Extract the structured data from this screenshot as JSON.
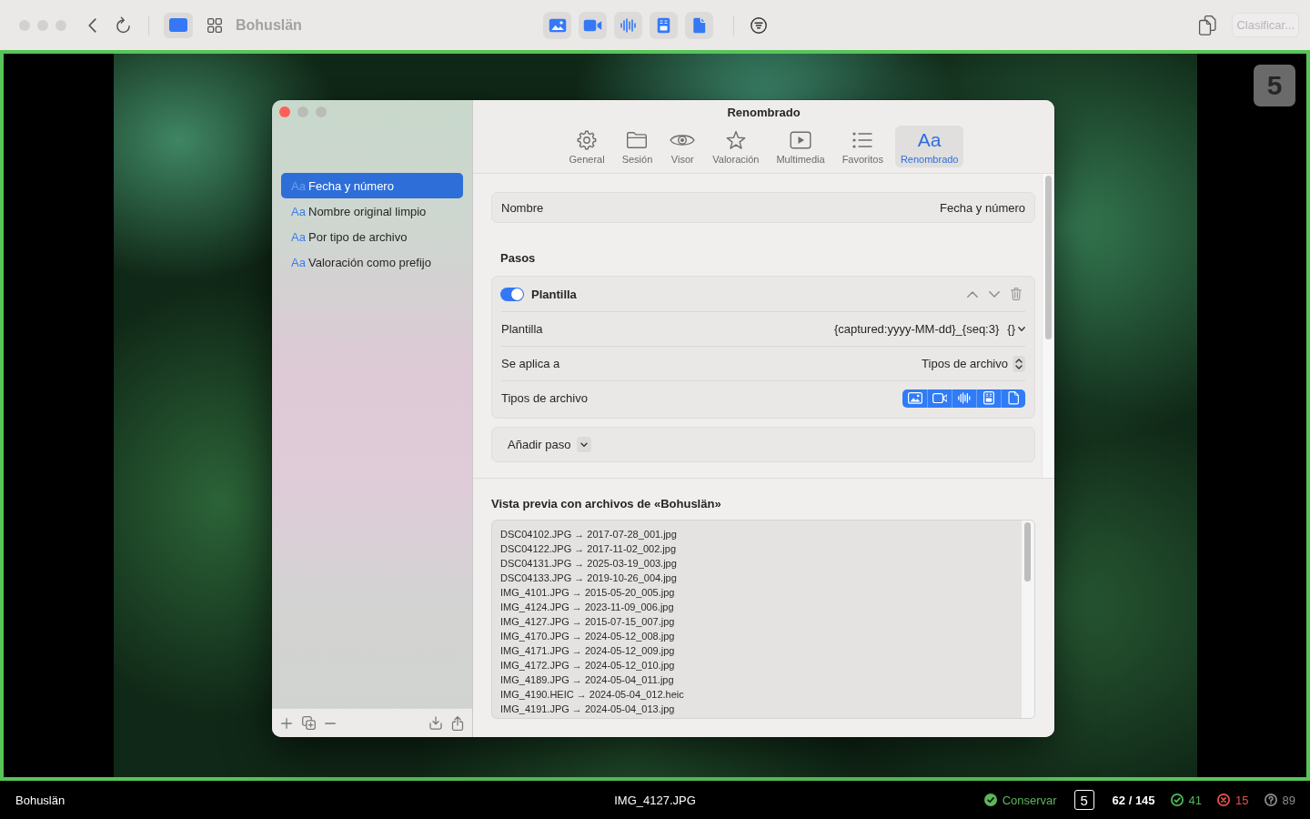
{
  "toolbar": {
    "title": "Bohuslän",
    "media_filters": [
      {
        "kind": "photo"
      },
      {
        "kind": "video"
      },
      {
        "kind": "audio"
      },
      {
        "kind": "document"
      },
      {
        "kind": "file"
      }
    ],
    "sort_button": {
      "label": "Clasificar...",
      "disabled": true
    }
  },
  "viewer": {
    "rating_badge": "5"
  },
  "dialog": {
    "title": "Renombrado",
    "tabs": [
      {
        "kind": "gear",
        "label": "General",
        "selected": false
      },
      {
        "kind": "folder",
        "label": "Sesión",
        "selected": false
      },
      {
        "kind": "eye",
        "label": "Visor",
        "selected": false
      },
      {
        "kind": "star",
        "label": "Valoración",
        "selected": false
      },
      {
        "kind": "play",
        "label": "Multimedia",
        "selected": false
      },
      {
        "kind": "list",
        "label": "Favoritos",
        "selected": false
      },
      {
        "kind": "glyph",
        "glyph": "Aa",
        "label": "Renombrado",
        "selected": true
      }
    ],
    "presets": [
      {
        "glyph": "Aa",
        "label": "Fecha y número",
        "selected": true
      },
      {
        "glyph": "Aa",
        "label": "Nombre original limpio",
        "selected": false
      },
      {
        "glyph": "Aa",
        "label": "Por tipo de archivo",
        "selected": false
      },
      {
        "glyph": "Aa",
        "label": "Valoración como prefijo",
        "selected": false
      }
    ],
    "name_field": {
      "label": "Nombre",
      "value": "Fecha y número"
    },
    "steps_heading": "Pasos",
    "steps": [
      {
        "title": "Plantilla",
        "enabled": true,
        "rows": [
          {
            "kind": "template",
            "label": "Plantilla",
            "value": "{captured:yyyy-MM-dd}_{seq:3}",
            "token_button": "{}"
          },
          {
            "kind": "popup",
            "label": "Se aplica a",
            "value": "Tipos de archivo"
          },
          {
            "kind": "types",
            "label": "Tipos de archivo",
            "types": [
              {
                "kind": "photo",
                "selected": true
              },
              {
                "kind": "video",
                "selected": true
              },
              {
                "kind": "audio",
                "selected": true
              },
              {
                "kind": "document",
                "selected": true
              },
              {
                "kind": "file",
                "selected": true
              }
            ]
          }
        ]
      }
    ],
    "add_step": "Añadir paso",
    "preview": {
      "title": "Vista previa con archivos de «Bohuslän»",
      "lines": [
        "DSC04102.JPG → 2017-07-28_001.jpg",
        "DSC04122.JPG → 2017-11-02_002.jpg",
        "DSC04131.JPG → 2025-03-19_003.jpg",
        "DSC04133.JPG → 2019-10-26_004.jpg",
        "IMG_4101.JPG → 2015-05-20_005.jpg",
        "IMG_4124.JPG → 2023-11-09_006.jpg",
        "IMG_4127.JPG → 2015-07-15_007.jpg",
        "IMG_4170.JPG → 2024-05-12_008.jpg",
        "IMG_4171.JPG → 2024-05-12_009.jpg",
        "IMG_4172.JPG → 2024-05-12_010.jpg",
        "IMG_4189.JPG → 2024-05-04_011.jpg",
        "IMG_4190.HEIC → 2024-05-04_012.heic",
        "IMG_4191.JPG → 2024-05-04_013.jpg"
      ]
    }
  },
  "status_bar": {
    "folder": "Bohuslän",
    "filename": "IMG_4127.JPG",
    "verdict": {
      "kind": "keep",
      "label": "Conservar"
    },
    "rating": "5",
    "position": "62 / 145",
    "counts": [
      {
        "kind": "keep",
        "value": "41",
        "color": "#4fb95a"
      },
      {
        "kind": "reject",
        "value": "15",
        "color": "#e5524b"
      },
      {
        "kind": "unknown",
        "value": "89",
        "color": "#8a8a8e"
      }
    ]
  }
}
